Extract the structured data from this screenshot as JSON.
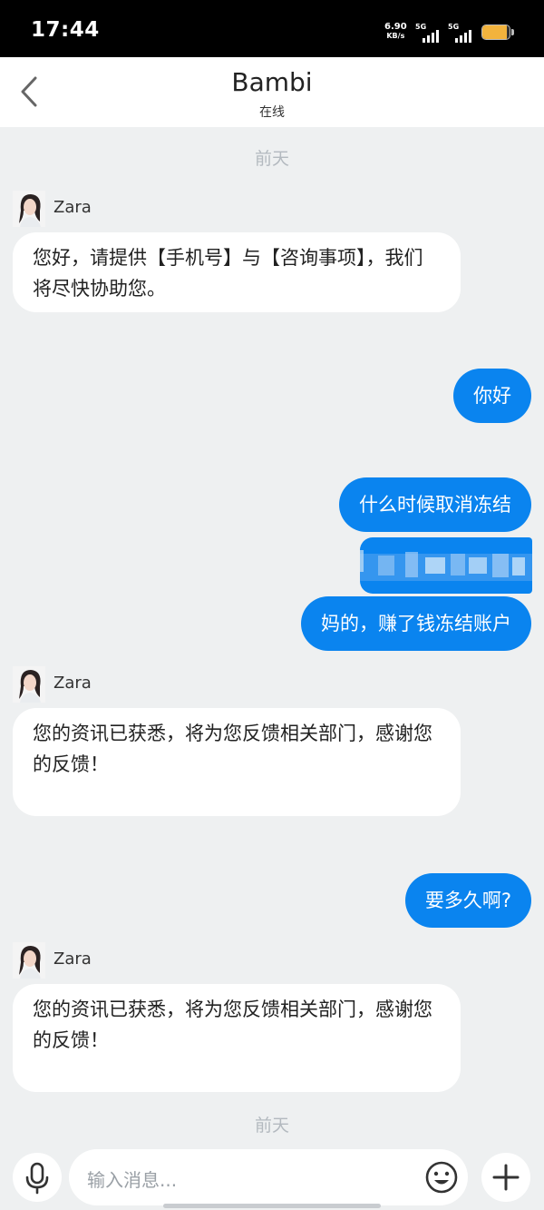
{
  "status_bar": {
    "time": "17:44",
    "net_speed": "6.90",
    "net_unit": "KB/s",
    "sim1": "5G",
    "sim2": "5G",
    "battery_level": 0.9,
    "battery_color": "#f2b33d"
  },
  "header": {
    "title": "Bambi",
    "subtitle": "在线",
    "back_icon": "chevron-left-icon"
  },
  "messages": {
    "timestamp_top": "前天",
    "agent_name": "Zara",
    "m1": "您好，请提供【手机号】与【咨询事项】，我们将尽快协助您。",
    "m2": "你好",
    "m3": "什么时候取消冻结",
    "m4": "妈的，赚了钱冻结账户",
    "m5": "您的资讯已获悉，将为您反馈相关部门，感谢您的反馈！",
    "m6": "要多久啊?",
    "m7": "您的资讯已获悉，将为您反馈相关部门，感谢您的反馈！",
    "timestamp_bottom": "前天"
  },
  "input": {
    "placeholder": "输入消息...",
    "mic_icon": "microphone-icon",
    "emoji_icon": "smiley-icon",
    "add_icon": "plus-icon"
  },
  "colors": {
    "outgoing_bubble": "#0a84ef",
    "incoming_bubble": "#ffffff",
    "background": "#eef0f1"
  }
}
